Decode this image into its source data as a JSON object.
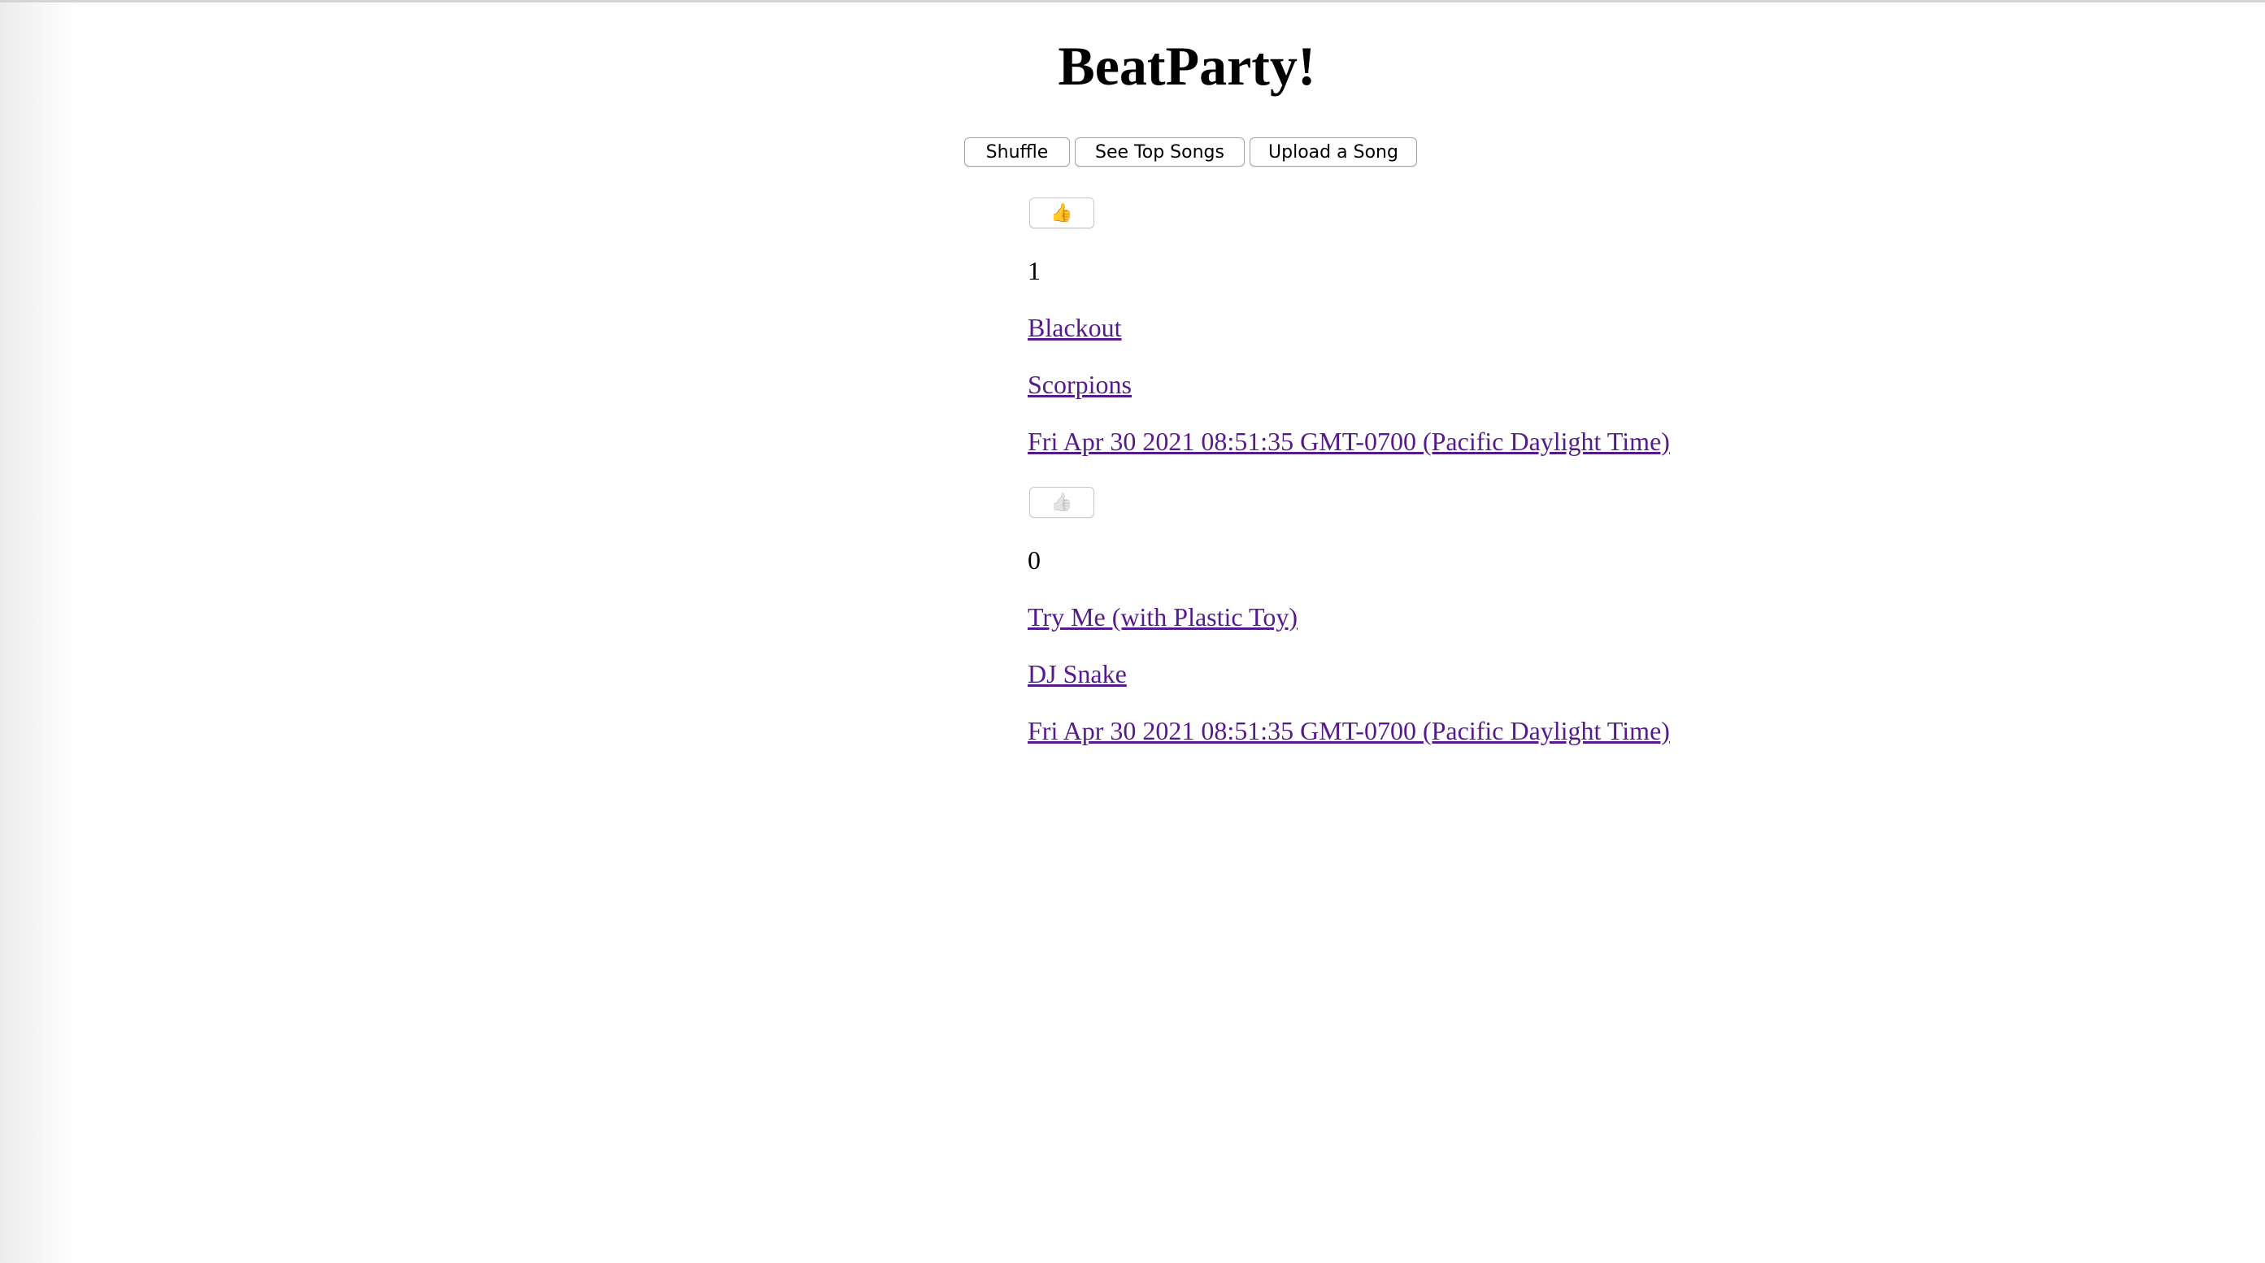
{
  "app": {
    "title": "BeatParty!"
  },
  "toolbar": {
    "shuffle_label": "Shuffle",
    "top_songs_label": "See Top Songs",
    "upload_label": "Upload a Song"
  },
  "songs": [
    {
      "like_icon": "👍",
      "like_state": "liked",
      "likes": "1",
      "title": "Blackout",
      "artist": "Scorpions",
      "date": "Fri Apr 30 2021 08:51:35 GMT-0700 (Pacific Daylight Time)"
    },
    {
      "like_icon": "👍",
      "like_state": "not-liked",
      "likes": "0",
      "title": "Try Me (with Plastic Toy)",
      "artist": "DJ Snake",
      "date": "Fri Apr 30 2021 08:51:35 GMT-0700 (Pacific Daylight Time)"
    }
  ],
  "colors": {
    "link_visited": "#551a8b",
    "liked_icon": "#f1a800",
    "unliked_icon": "#b8b8b8"
  }
}
